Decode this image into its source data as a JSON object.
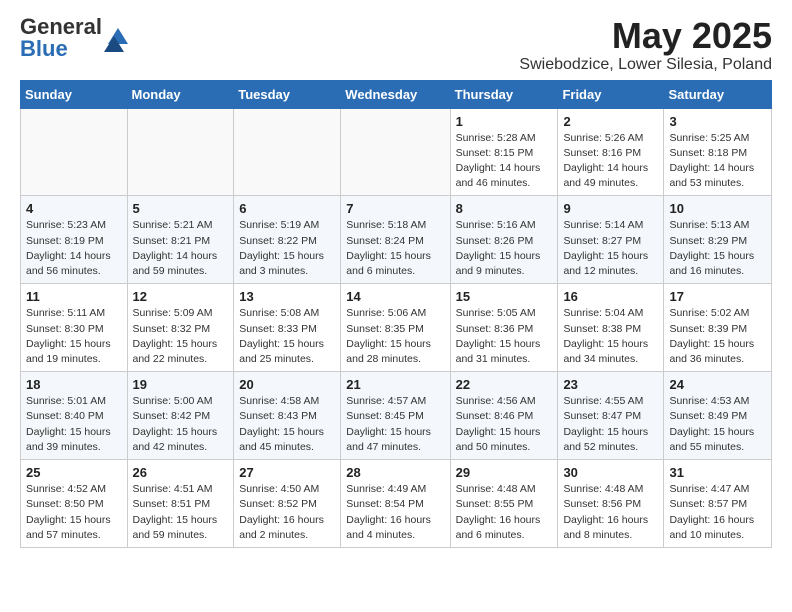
{
  "logo": {
    "general": "General",
    "blue": "Blue"
  },
  "header": {
    "title": "May 2025",
    "subtitle": "Swiebodzice, Lower Silesia, Poland"
  },
  "weekdays": [
    "Sunday",
    "Monday",
    "Tuesday",
    "Wednesday",
    "Thursday",
    "Friday",
    "Saturday"
  ],
  "weeks": [
    [
      {
        "day": "",
        "info": ""
      },
      {
        "day": "",
        "info": ""
      },
      {
        "day": "",
        "info": ""
      },
      {
        "day": "",
        "info": ""
      },
      {
        "day": "1",
        "info": "Sunrise: 5:28 AM\nSunset: 8:15 PM\nDaylight: 14 hours\nand 46 minutes."
      },
      {
        "day": "2",
        "info": "Sunrise: 5:26 AM\nSunset: 8:16 PM\nDaylight: 14 hours\nand 49 minutes."
      },
      {
        "day": "3",
        "info": "Sunrise: 5:25 AM\nSunset: 8:18 PM\nDaylight: 14 hours\nand 53 minutes."
      }
    ],
    [
      {
        "day": "4",
        "info": "Sunrise: 5:23 AM\nSunset: 8:19 PM\nDaylight: 14 hours\nand 56 minutes."
      },
      {
        "day": "5",
        "info": "Sunrise: 5:21 AM\nSunset: 8:21 PM\nDaylight: 14 hours\nand 59 minutes."
      },
      {
        "day": "6",
        "info": "Sunrise: 5:19 AM\nSunset: 8:22 PM\nDaylight: 15 hours\nand 3 minutes."
      },
      {
        "day": "7",
        "info": "Sunrise: 5:18 AM\nSunset: 8:24 PM\nDaylight: 15 hours\nand 6 minutes."
      },
      {
        "day": "8",
        "info": "Sunrise: 5:16 AM\nSunset: 8:26 PM\nDaylight: 15 hours\nand 9 minutes."
      },
      {
        "day": "9",
        "info": "Sunrise: 5:14 AM\nSunset: 8:27 PM\nDaylight: 15 hours\nand 12 minutes."
      },
      {
        "day": "10",
        "info": "Sunrise: 5:13 AM\nSunset: 8:29 PM\nDaylight: 15 hours\nand 16 minutes."
      }
    ],
    [
      {
        "day": "11",
        "info": "Sunrise: 5:11 AM\nSunset: 8:30 PM\nDaylight: 15 hours\nand 19 minutes."
      },
      {
        "day": "12",
        "info": "Sunrise: 5:09 AM\nSunset: 8:32 PM\nDaylight: 15 hours\nand 22 minutes."
      },
      {
        "day": "13",
        "info": "Sunrise: 5:08 AM\nSunset: 8:33 PM\nDaylight: 15 hours\nand 25 minutes."
      },
      {
        "day": "14",
        "info": "Sunrise: 5:06 AM\nSunset: 8:35 PM\nDaylight: 15 hours\nand 28 minutes."
      },
      {
        "day": "15",
        "info": "Sunrise: 5:05 AM\nSunset: 8:36 PM\nDaylight: 15 hours\nand 31 minutes."
      },
      {
        "day": "16",
        "info": "Sunrise: 5:04 AM\nSunset: 8:38 PM\nDaylight: 15 hours\nand 34 minutes."
      },
      {
        "day": "17",
        "info": "Sunrise: 5:02 AM\nSunset: 8:39 PM\nDaylight: 15 hours\nand 36 minutes."
      }
    ],
    [
      {
        "day": "18",
        "info": "Sunrise: 5:01 AM\nSunset: 8:40 PM\nDaylight: 15 hours\nand 39 minutes."
      },
      {
        "day": "19",
        "info": "Sunrise: 5:00 AM\nSunset: 8:42 PM\nDaylight: 15 hours\nand 42 minutes."
      },
      {
        "day": "20",
        "info": "Sunrise: 4:58 AM\nSunset: 8:43 PM\nDaylight: 15 hours\nand 45 minutes."
      },
      {
        "day": "21",
        "info": "Sunrise: 4:57 AM\nSunset: 8:45 PM\nDaylight: 15 hours\nand 47 minutes."
      },
      {
        "day": "22",
        "info": "Sunrise: 4:56 AM\nSunset: 8:46 PM\nDaylight: 15 hours\nand 50 minutes."
      },
      {
        "day": "23",
        "info": "Sunrise: 4:55 AM\nSunset: 8:47 PM\nDaylight: 15 hours\nand 52 minutes."
      },
      {
        "day": "24",
        "info": "Sunrise: 4:53 AM\nSunset: 8:49 PM\nDaylight: 15 hours\nand 55 minutes."
      }
    ],
    [
      {
        "day": "25",
        "info": "Sunrise: 4:52 AM\nSunset: 8:50 PM\nDaylight: 15 hours\nand 57 minutes."
      },
      {
        "day": "26",
        "info": "Sunrise: 4:51 AM\nSunset: 8:51 PM\nDaylight: 15 hours\nand 59 minutes."
      },
      {
        "day": "27",
        "info": "Sunrise: 4:50 AM\nSunset: 8:52 PM\nDaylight: 16 hours\nand 2 minutes."
      },
      {
        "day": "28",
        "info": "Sunrise: 4:49 AM\nSunset: 8:54 PM\nDaylight: 16 hours\nand 4 minutes."
      },
      {
        "day": "29",
        "info": "Sunrise: 4:48 AM\nSunset: 8:55 PM\nDaylight: 16 hours\nand 6 minutes."
      },
      {
        "day": "30",
        "info": "Sunrise: 4:48 AM\nSunset: 8:56 PM\nDaylight: 16 hours\nand 8 minutes."
      },
      {
        "day": "31",
        "info": "Sunrise: 4:47 AM\nSunset: 8:57 PM\nDaylight: 16 hours\nand 10 minutes."
      }
    ]
  ]
}
